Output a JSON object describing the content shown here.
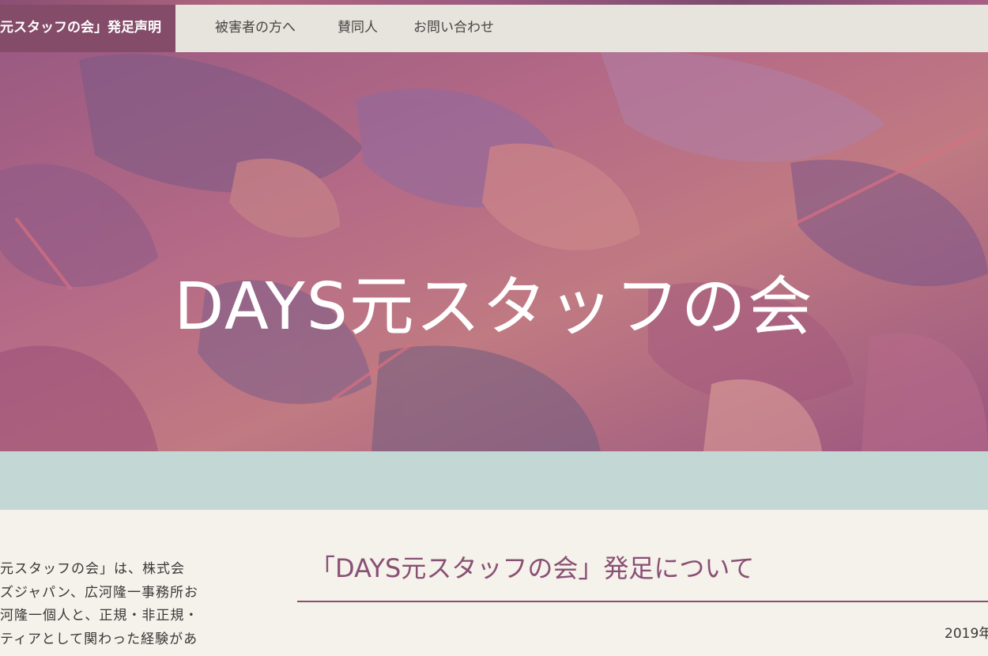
{
  "nav": {
    "items": [
      {
        "label": "元スタッフの会」発足声明",
        "active": true
      },
      {
        "label": "被害者の方へ",
        "active": false
      },
      {
        "label": "賛同人",
        "active": false
      },
      {
        "label": "お問い合わせ",
        "active": false
      }
    ]
  },
  "hero": {
    "title": "DAYS元スタッフの会"
  },
  "sidebar": {
    "lines": [
      "元スタッフの会」は、株式会",
      "ズジャパン、広河隆一事務所お",
      "河隆一個人と、正規・非正規・",
      "ティアとして関わった経験があ"
    ]
  },
  "article": {
    "title": "「DAYS元スタッフの会」発足について",
    "date": "2019年"
  },
  "colors": {
    "accent": "#844c68",
    "nav_bg": "#e6e4dc",
    "band": "#c3d7d4",
    "page_bg": "#f4f2ea"
  }
}
